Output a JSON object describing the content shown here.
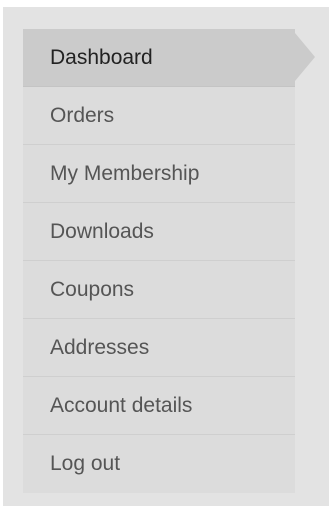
{
  "account_nav": {
    "items": [
      {
        "label": "Dashboard",
        "active": true
      },
      {
        "label": "Orders"
      },
      {
        "label": "My Membership"
      },
      {
        "label": "Downloads"
      },
      {
        "label": "Coupons"
      },
      {
        "label": "Addresses"
      },
      {
        "label": "Account details"
      },
      {
        "label": "Log out"
      }
    ]
  },
  "colors": {
    "panel_background": "#e3e3e3",
    "item_background": "#dcdcdc",
    "active_background": "#cbcbcb",
    "text": "#555555"
  }
}
